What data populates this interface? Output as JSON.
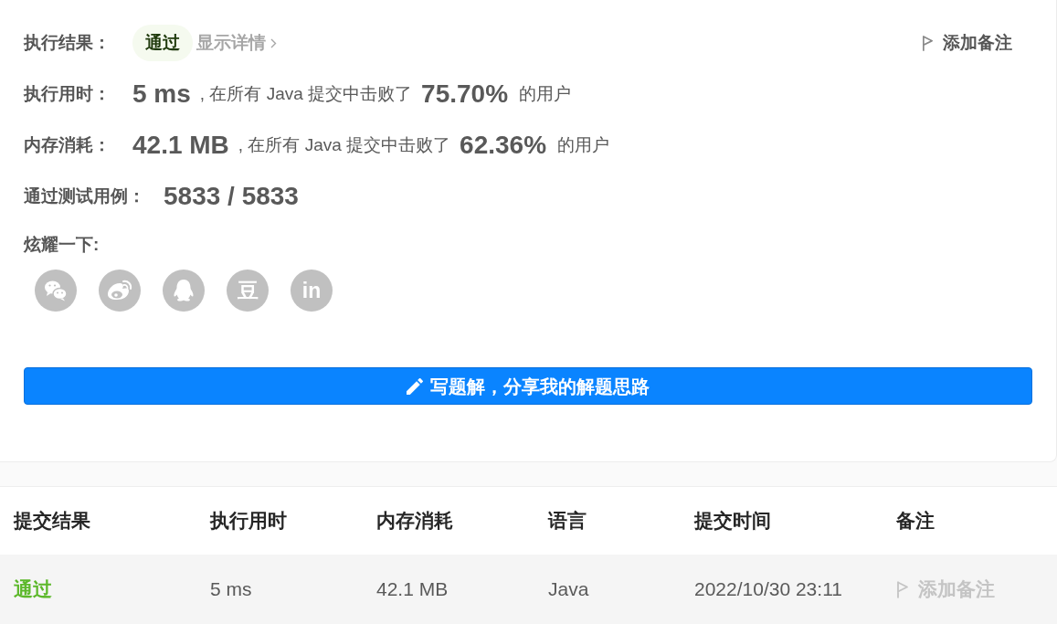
{
  "result": {
    "label": "执行结果：",
    "status": {
      "text": "通过",
      "kind": "accepted"
    },
    "details_link": "显示详情",
    "add_note": "添加备注"
  },
  "stats": [
    {
      "label": "执行用时：",
      "value": "5 ms",
      "comparison": ", 在所有 Java 提交中击败了",
      "percent": "75.70%",
      "suffix": "的用户"
    },
    {
      "label": "内存消耗：",
      "value": "42.1 MB",
      "comparison": ", 在所有 Java 提交中击败了",
      "percent": "62.36%",
      "suffix": "的用户"
    }
  ],
  "tests": {
    "label": "通过测试用例：",
    "value": "5833 / 5833"
  },
  "share": {
    "label": "炫耀一下:",
    "icons": [
      {
        "kind": "bubbles"
      },
      {
        "kind": "eye"
      },
      {
        "kind": "penguin"
      },
      {
        "kind": "glyph",
        "glyph": "豆"
      },
      {
        "kind": "glyph",
        "glyph": "in"
      }
    ]
  },
  "solution_button": "写题解，分享我的解题思路",
  "table": {
    "columns": [
      "提交结果",
      "执行用时",
      "内存消耗",
      "语言",
      "提交时间",
      "备注"
    ],
    "rows": [
      {
        "cells": [
          {
            "kind": "status",
            "text": "通过"
          },
          {
            "kind": "plain",
            "text": "5 ms"
          },
          {
            "kind": "plain",
            "text": "42.1 MB"
          },
          {
            "kind": "plain",
            "text": "Java"
          },
          {
            "kind": "plain",
            "text": "2022/10/30 23:11"
          },
          {
            "kind": "note",
            "text": "添加备注"
          }
        ]
      }
    ]
  }
}
